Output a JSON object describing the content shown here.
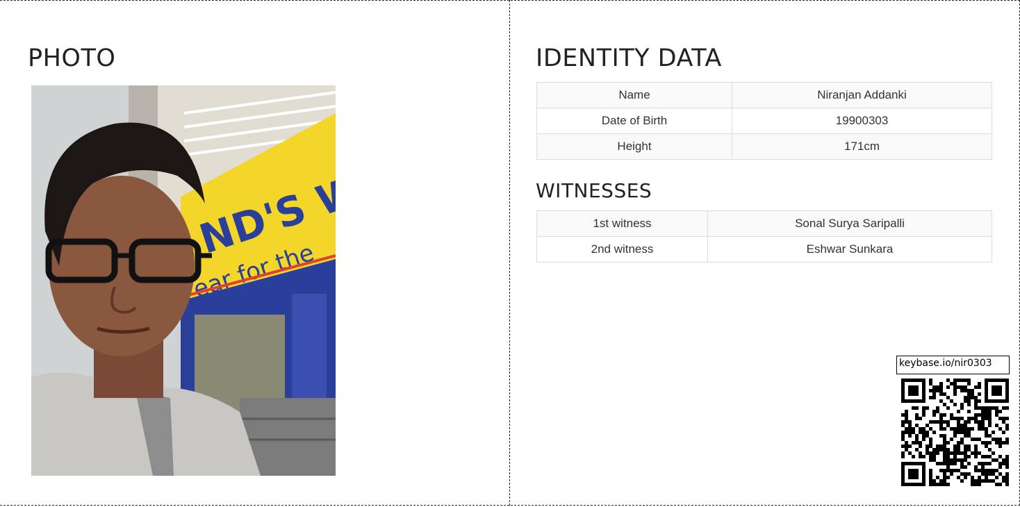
{
  "photo": {
    "title": "PHOTO"
  },
  "identity": {
    "title": "IDENTITY DATA",
    "rows": [
      {
        "label": "Name",
        "value": "Niranjan Addanki"
      },
      {
        "label": "Date of Birth",
        "value": "19900303"
      },
      {
        "label": "Height",
        "value": "171cm"
      }
    ]
  },
  "witnesses": {
    "title": "WITNESSES",
    "rows": [
      {
        "label": "1st witness",
        "value": "Sonal Surya Saripalli"
      },
      {
        "label": "2nd witness",
        "value": "Eshwar Sunkara"
      }
    ]
  },
  "qr": {
    "label": "keybase.io/nir0303"
  },
  "colors": {
    "sign_yellow": "#f4d62a",
    "storefront_blue": "#2a3f9a",
    "table_border": "#dddddd"
  }
}
